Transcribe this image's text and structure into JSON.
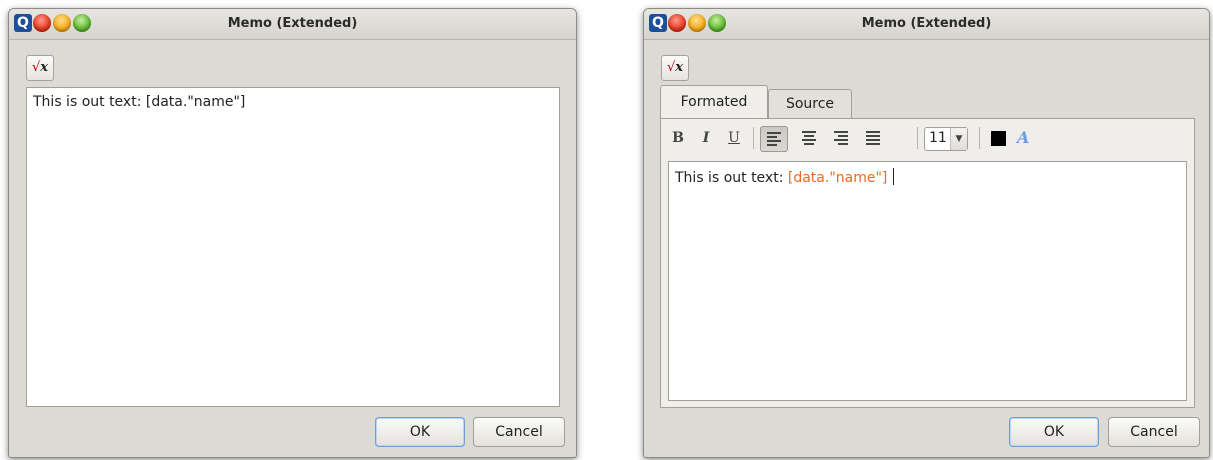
{
  "window_left": {
    "title": "Memo (Extended)",
    "app_icon": "Q",
    "insert_expression_button": "√x",
    "editor_text": "This is out text: [data.\"name\"]",
    "ok_label": "OK",
    "cancel_label": "Cancel"
  },
  "window_right": {
    "title": "Memo (Extended)",
    "app_icon": "Q",
    "insert_expression_button": "√x",
    "tabs": [
      {
        "label": "Formated",
        "active": true
      },
      {
        "label": "Source",
        "active": false
      }
    ],
    "toolbar": {
      "bold_label": "B",
      "italic_label": "I",
      "underline_label": "U",
      "align_options": [
        "align-left-icon",
        "align-center-icon",
        "align-right-icon",
        "align-justify-icon"
      ],
      "active_align": "align-left-icon",
      "font_size": "11",
      "text_color": "#000000",
      "highlight_icon": "A"
    },
    "editor_text_prefix": "This is out text: ",
    "editor_token": "[data.\"name\"]",
    "token_color": "#f06a1e",
    "ok_label": "OK",
    "cancel_label": "Cancel"
  }
}
